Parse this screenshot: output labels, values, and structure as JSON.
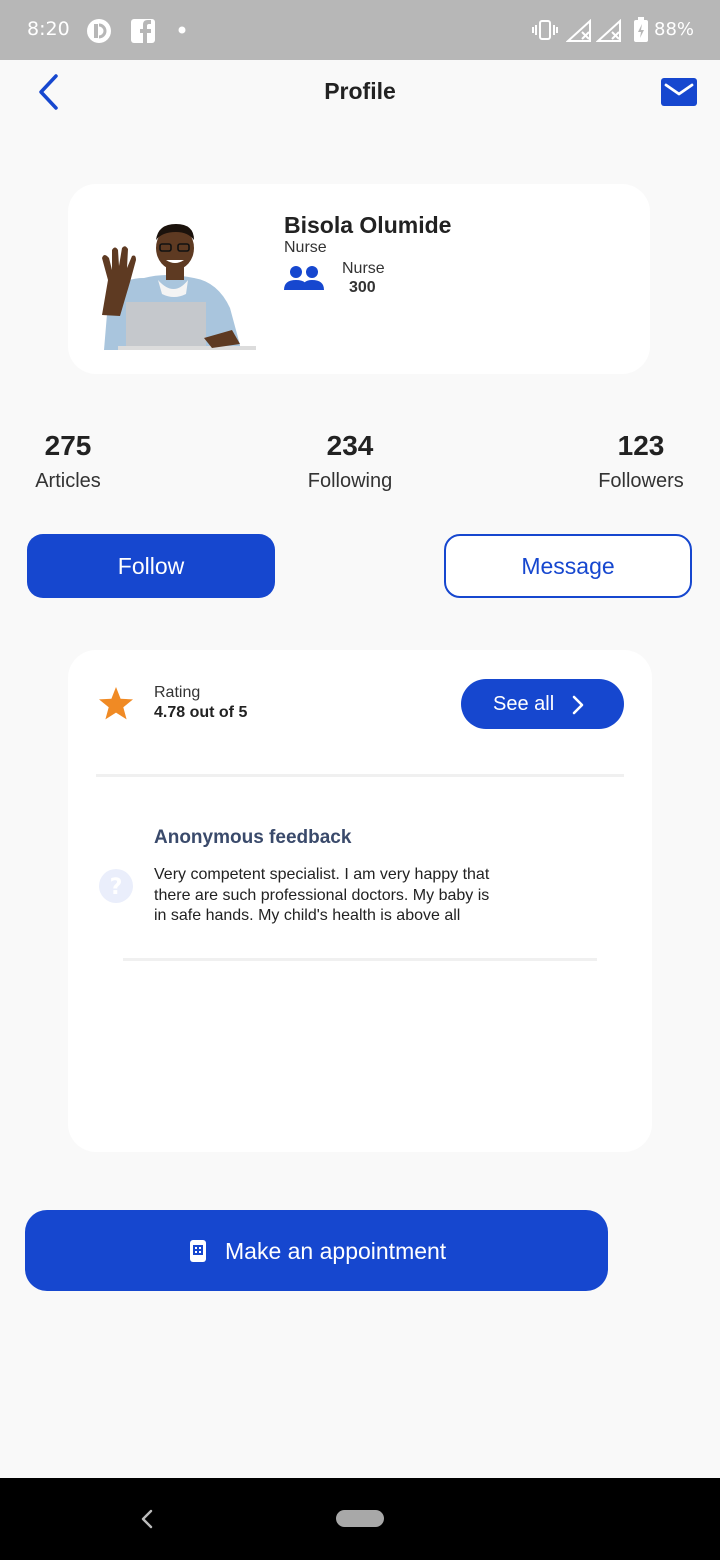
{
  "status_bar": {
    "time": "8:20",
    "battery": "88%"
  },
  "header": {
    "title": "Profile"
  },
  "profile": {
    "name": "Bisola Olumide",
    "role": "Nurse",
    "stat_label": "Nurse",
    "stat_value": "300"
  },
  "stats": [
    {
      "value": "275",
      "label": "Articles"
    },
    {
      "value": "234",
      "label": "Following"
    },
    {
      "value": "123",
      "label": "Followers"
    }
  ],
  "actions": {
    "follow": "Follow",
    "message": "Message"
  },
  "rating": {
    "label": "Rating",
    "value": "4.78 out of 5",
    "see_all": "See all"
  },
  "feedback": {
    "title": "Anonymous feedback",
    "text": "Very competent specialist. I am very happy that there are such professional doctors. My baby is in safe hands. My child's health is above all"
  },
  "appointment": {
    "label": "Make an appointment"
  },
  "colors": {
    "primary": "#1647cf",
    "star": "#f08a24",
    "background": "#f9f9f9"
  },
  "icons": [
    "back-icon",
    "mail-icon",
    "group-icon",
    "star-icon",
    "question-icon",
    "chevron-right-icon",
    "phone-icon"
  ]
}
